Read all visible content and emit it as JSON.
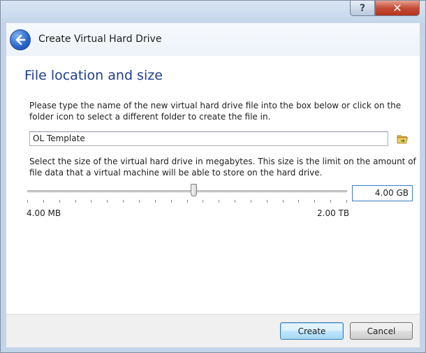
{
  "titlebar": {
    "help_label": "?",
    "close_label": "✕"
  },
  "wizard": {
    "title": "Create Virtual Hard Drive",
    "back_icon": "back-arrow-icon"
  },
  "page": {
    "section_title": "File location and size",
    "location_instructions": "Please type the name of the new virtual hard drive file into the box below or click on the folder icon to select a different folder to create the file in.",
    "file_name": "OL Template",
    "folder_icon": "folder-open-icon",
    "size_instructions": "Select the size of the virtual hard drive in megabytes. This size is the limit on the amount of file data that a virtual machine will be able to store on the hard drive.",
    "size_value": "4.00 GB",
    "slider_position": 0.52,
    "slider_min_label": "4.00 MB",
    "slider_max_label": "2.00 TB"
  },
  "buttons": {
    "create": "Create",
    "cancel": "Cancel"
  },
  "colors": {
    "section_title": "#1e3d8f",
    "frame": "#c3d4e8",
    "close_button": "#c44b35"
  }
}
